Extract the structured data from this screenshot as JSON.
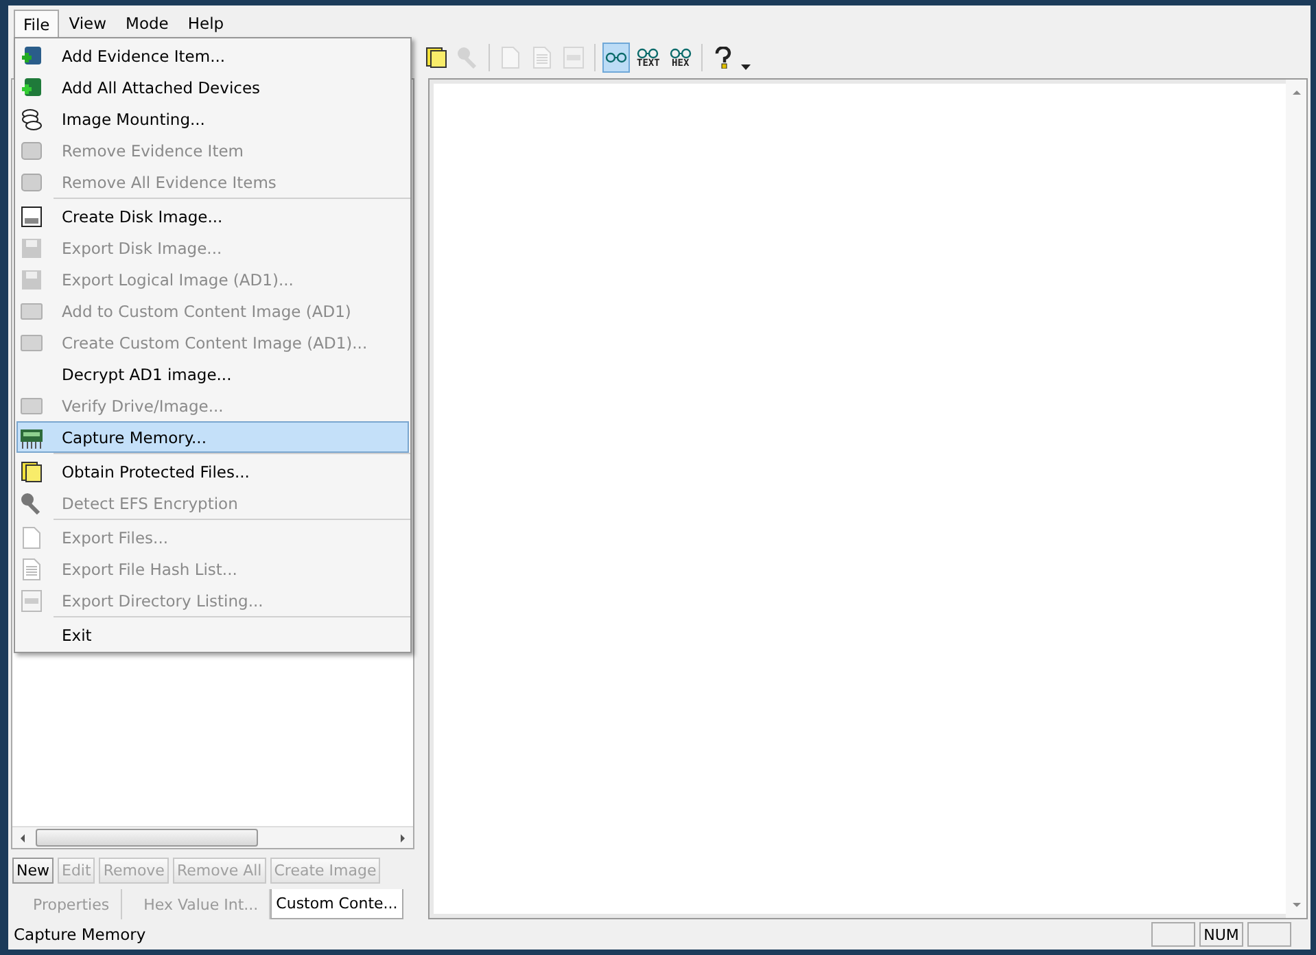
{
  "menubar": [
    {
      "label": "File",
      "selected": true
    },
    {
      "label": "View",
      "selected": false
    },
    {
      "label": "Mode",
      "selected": false
    },
    {
      "label": "Help",
      "selected": false
    }
  ],
  "file_menu": [
    [
      {
        "label": "Add Evidence Item...",
        "kind": "evidence-add",
        "disabled": false,
        "selected": false
      },
      {
        "label": "Add All Attached Devices",
        "kind": "devices-add",
        "disabled": false,
        "selected": false
      },
      {
        "label": "Image Mounting...",
        "kind": "mount",
        "disabled": false,
        "selected": false
      },
      {
        "label": "Remove Evidence Item",
        "kind": "evidence-remove",
        "disabled": true,
        "selected": false
      },
      {
        "label": "Remove All Evidence Items",
        "kind": "evidence-remove",
        "disabled": true,
        "selected": false
      }
    ],
    [
      {
        "label": "Create Disk Image...",
        "kind": "disk",
        "disabled": false,
        "selected": false
      },
      {
        "label": "Export Disk Image...",
        "kind": "floppy",
        "disabled": true,
        "selected": false
      },
      {
        "label": "Export Logical Image (AD1)...",
        "kind": "floppy",
        "disabled": true,
        "selected": false
      },
      {
        "label": "Add to Custom Content Image (AD1)",
        "kind": "drive",
        "disabled": true,
        "selected": false
      },
      {
        "label": "Create Custom Content Image (AD1)...",
        "kind": "drive",
        "disabled": true,
        "selected": false
      },
      {
        "label": "Decrypt AD1 image...",
        "kind": "plain",
        "disabled": false,
        "selected": false
      },
      {
        "label": "Verify Drive/Image...",
        "kind": "drive",
        "disabled": true,
        "selected": false
      },
      {
        "label": "Capture Memory...",
        "kind": "memory",
        "disabled": false,
        "selected": true
      }
    ],
    [
      {
        "label": "Obtain Protected Files...",
        "kind": "protected",
        "disabled": false,
        "selected": false
      },
      {
        "label": "Detect EFS Encryption",
        "kind": "key",
        "disabled": true,
        "selected": false
      }
    ],
    [
      {
        "label": "Export Files...",
        "kind": "file",
        "disabled": true,
        "selected": false
      },
      {
        "label": "Export File Hash List...",
        "kind": "file-lines",
        "disabled": true,
        "selected": false
      },
      {
        "label": "Export Directory Listing...",
        "kind": "dir",
        "disabled": true,
        "selected": false
      }
    ],
    [
      {
        "label": "Exit",
        "kind": "plain",
        "disabled": false,
        "selected": false
      }
    ]
  ],
  "toolbar": [
    {
      "kind": "protected",
      "disabled": false
    },
    {
      "kind": "key",
      "disabled": true
    },
    {
      "kind": "separator"
    },
    {
      "kind": "file",
      "disabled": true
    },
    {
      "kind": "file-lines",
      "disabled": true
    },
    {
      "kind": "dir",
      "disabled": true
    },
    {
      "kind": "separator"
    },
    {
      "kind": "glasses",
      "selected": true
    },
    {
      "kind": "glasses",
      "label": "TEXT",
      "selected": false
    },
    {
      "kind": "glasses",
      "label": "HEX",
      "selected": false
    },
    {
      "kind": "separator"
    },
    {
      "kind": "help",
      "disabled": false
    },
    {
      "kind": "overflow"
    }
  ],
  "left_pane": {
    "buttons": [
      {
        "label": "New",
        "disabled": false
      },
      {
        "label": "Edit",
        "disabled": true
      },
      {
        "label": "Remove",
        "disabled": true
      },
      {
        "label": "Remove All",
        "disabled": true
      },
      {
        "label": "Create Image",
        "disabled": true
      }
    ],
    "tabs": [
      {
        "label": "Properties",
        "selected": false
      },
      {
        "label": "Hex Value Int...",
        "selected": false
      },
      {
        "label": "Custom Conte...",
        "selected": true
      }
    ]
  },
  "status_bar": {
    "message": "Capture Memory",
    "num_indicator": "NUM"
  }
}
